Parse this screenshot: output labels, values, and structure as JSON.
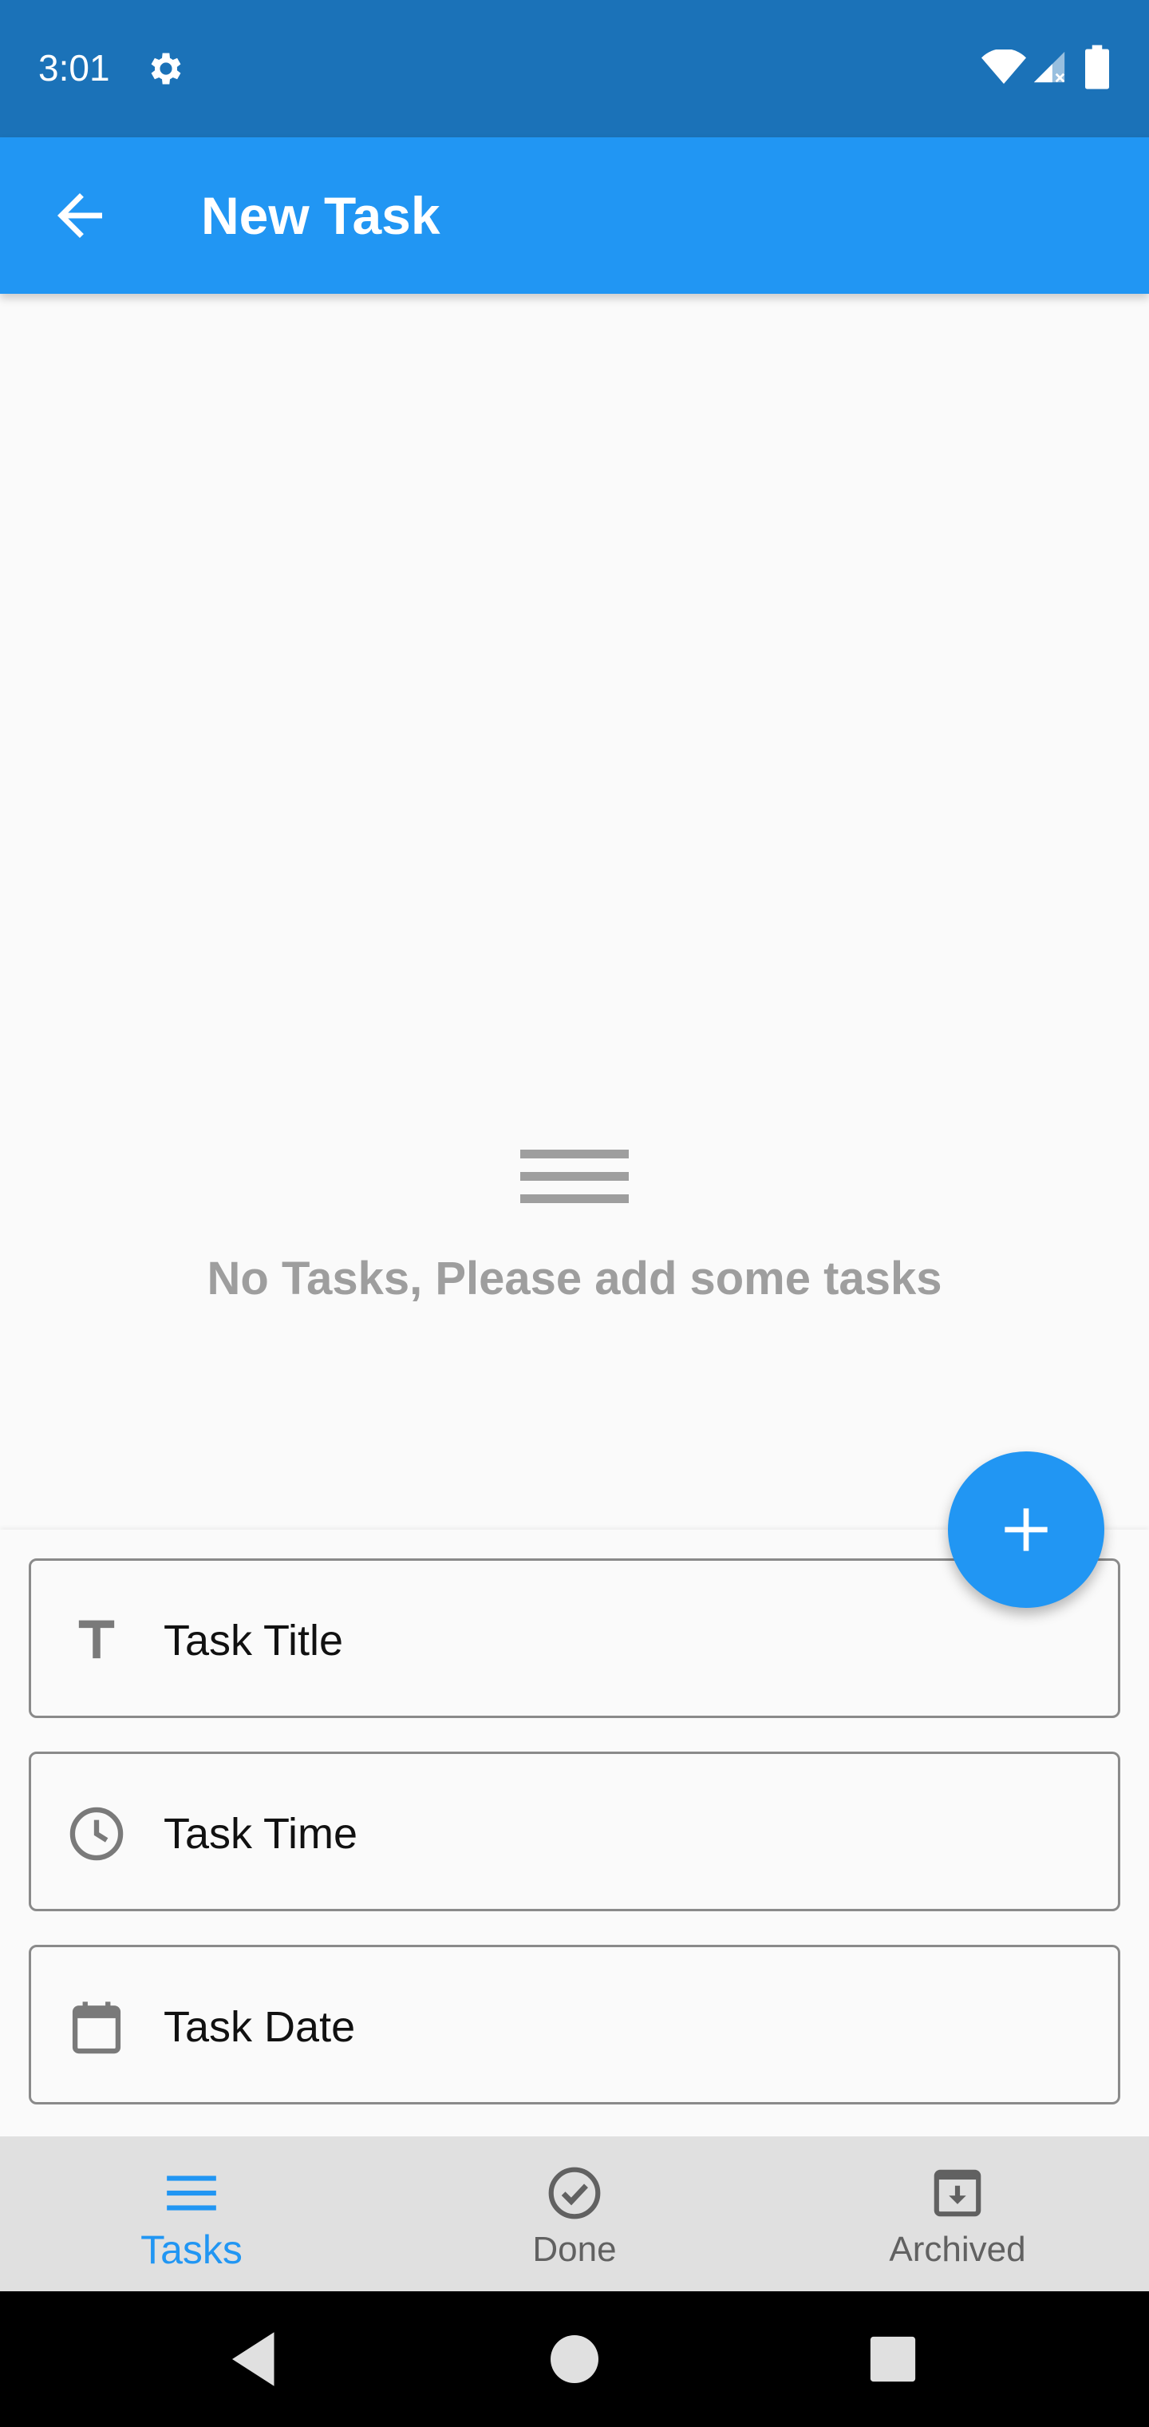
{
  "status_bar": {
    "time": "3:01",
    "icons": [
      "gear-icon",
      "wifi-icon",
      "signal-icon",
      "battery-icon"
    ]
  },
  "app_bar": {
    "title": "New Task",
    "back_icon": "arrow-back-icon"
  },
  "empty_state": {
    "icon": "menu-icon",
    "message": "No Tasks, Please add some tasks"
  },
  "form": {
    "title_field": {
      "label": "Task Title",
      "icon": "title-icon"
    },
    "time_field": {
      "label": "Task Time",
      "icon": "clock-icon"
    },
    "date_field": {
      "label": "Task Date",
      "icon": "calendar-icon"
    }
  },
  "fab": {
    "icon": "plus-icon"
  },
  "bottom_nav": {
    "items": [
      {
        "label": "Tasks",
        "icon": "menu-icon",
        "active": true
      },
      {
        "label": "Done",
        "icon": "check-circle-icon",
        "active": false
      },
      {
        "label": "Archived",
        "icon": "archive-icon",
        "active": false
      }
    ]
  },
  "colors": {
    "status_bar": "#1b72b8",
    "primary": "#2196f3",
    "background": "#fafafa",
    "nav_background": "#e0e0e0",
    "muted_text": "#9e9e9e"
  }
}
